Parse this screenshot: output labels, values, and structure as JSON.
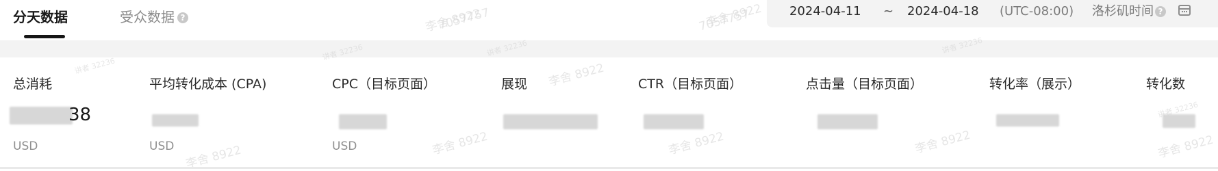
{
  "tabs": [
    {
      "label": "分天数据",
      "active": true
    },
    {
      "label": "受众数据",
      "active": false
    }
  ],
  "date_range": {
    "start": "2024-04-11",
    "separator": "~",
    "end": "2024-04-18",
    "timezone": "(UTC-08:00)",
    "timezone_name": "洛杉矶时间"
  },
  "metrics": [
    {
      "label": "总消耗",
      "value_tail": "38",
      "unit": "USD"
    },
    {
      "label": "平均转化成本 (CPA)",
      "unit": "USD"
    },
    {
      "label": "CPC（目标页面）",
      "unit": "USD"
    },
    {
      "label": "展现"
    },
    {
      "label": "CTR（目标页面）"
    },
    {
      "label": "点击量（目标页面）"
    },
    {
      "label": "转化率（展示）"
    },
    {
      "label": "转化数"
    }
  ],
  "watermarks": [
    "李舍 8922",
    "7057757",
    "讲者 32236"
  ],
  "icons": {
    "help": "help-icon",
    "calendar": "calendar-icon"
  }
}
